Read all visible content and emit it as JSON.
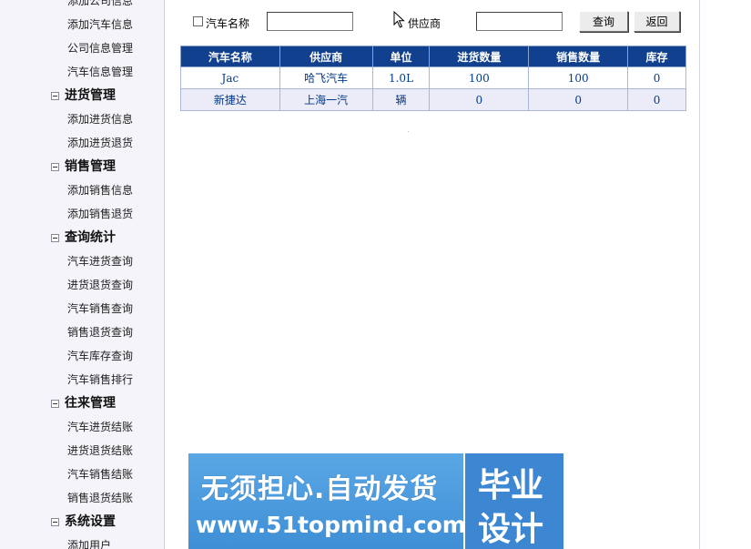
{
  "sidebar": {
    "rows": [
      {
        "type": "item",
        "label": "添加公司信息"
      },
      {
        "type": "item",
        "label": "添加汽车信息"
      },
      {
        "type": "item",
        "label": "公司信息管理"
      },
      {
        "type": "item",
        "label": "汽车信息管理"
      },
      {
        "type": "group",
        "label": "进货管理"
      },
      {
        "type": "item",
        "label": "添加进货信息"
      },
      {
        "type": "item",
        "label": "添加进货退货"
      },
      {
        "type": "group",
        "label": "销售管理"
      },
      {
        "type": "item",
        "label": "添加销售信息"
      },
      {
        "type": "item",
        "label": "添加销售退货"
      },
      {
        "type": "group",
        "label": "查询统计"
      },
      {
        "type": "item",
        "label": "汽车进货查询"
      },
      {
        "type": "item",
        "label": "进货退货查询"
      },
      {
        "type": "item",
        "label": "汽车销售查询"
      },
      {
        "type": "item",
        "label": "销售退货查询"
      },
      {
        "type": "item",
        "label": "汽车库存查询"
      },
      {
        "type": "item",
        "label": "汽车销售排行"
      },
      {
        "type": "group",
        "label": "往来管理"
      },
      {
        "type": "item",
        "label": "汽车进货结账"
      },
      {
        "type": "item",
        "label": "进货退货结账"
      },
      {
        "type": "item",
        "label": "汽车销售结账"
      },
      {
        "type": "item",
        "label": "销售退货结账"
      },
      {
        "type": "group",
        "label": "系统设置"
      },
      {
        "type": "item",
        "label": "添加用户"
      }
    ]
  },
  "search": {
    "car_name_label": "汽车名称",
    "car_name_value": "",
    "supplier_label": "供应商",
    "supplier_value": "",
    "query_label": "查询",
    "back_label": "返回"
  },
  "table": {
    "headers": [
      "汽车名称",
      "供应商",
      "单位",
      "进货数量",
      "销售数量",
      "库存"
    ],
    "rows": [
      [
        "Jac",
        "哈飞汽车",
        "1.0L",
        "100",
        "100",
        "0"
      ],
      [
        "新捷达",
        "上海一汽",
        "辆",
        "0",
        "0",
        "0"
      ]
    ]
  },
  "watermark": {
    "line1": "无须担心.自动发货",
    "line2": "www.51topmind.com",
    "right1": "毕业",
    "right2": "设计"
  }
}
